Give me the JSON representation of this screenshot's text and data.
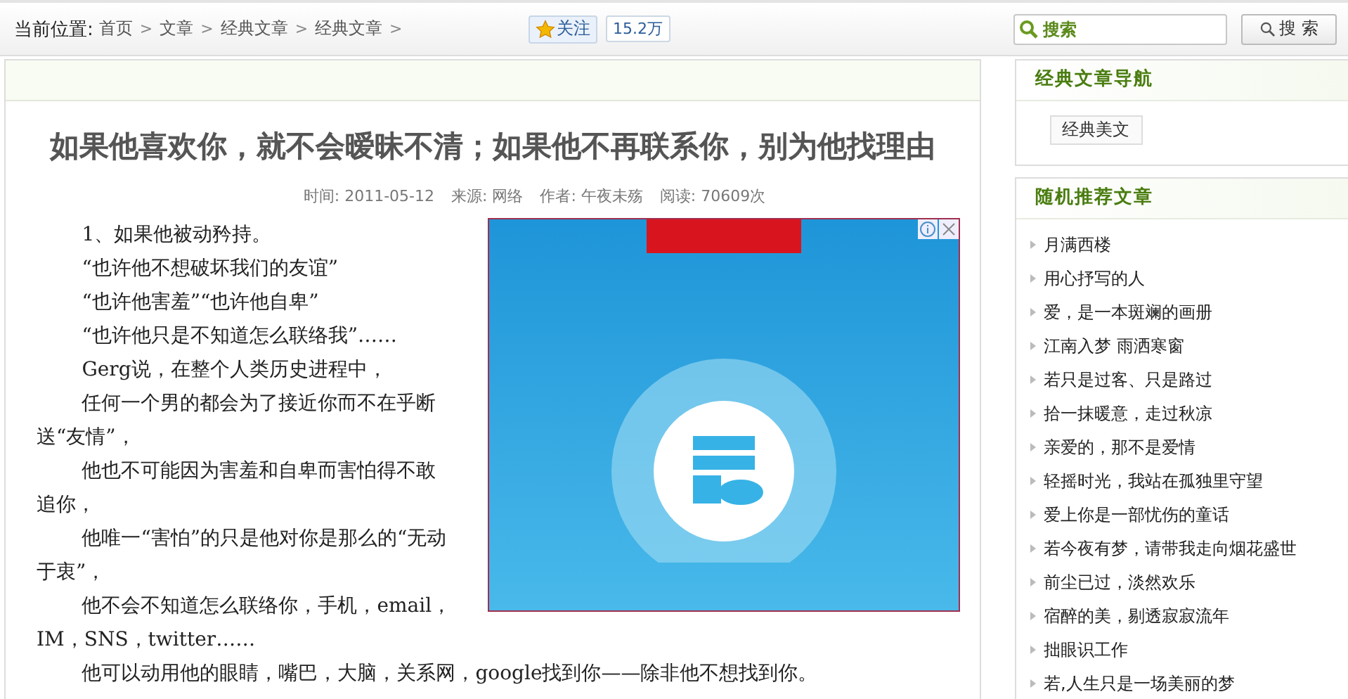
{
  "breadcrumb": {
    "label": "当前位置:",
    "items": [
      "首页",
      "文章",
      "经典文章",
      "经典文章"
    ],
    "separator": ">"
  },
  "follow": {
    "label": "关注",
    "count": "15.2万"
  },
  "search": {
    "placeholder": "搜索",
    "button": "搜 索"
  },
  "article": {
    "title": "如果他喜欢你，就不会暧昧不清；如果他不再联系你，别为他找理由",
    "meta": [
      {
        "label": "时间:",
        "value": "2011-05-12"
      },
      {
        "label": "来源:",
        "value": "网络"
      },
      {
        "label": "作者:",
        "value": "午夜未殇"
      },
      {
        "label": "阅读:",
        "value": "70609次"
      }
    ],
    "paragraphs": [
      "1、如果他被动矜持。",
      "“也许他不想破坏我们的友谊”",
      "“也许他害羞”“也许他自卑”",
      "“也许他只是不知道怎么联络我”……",
      "Gerg说，在整个人类历史进程中，",
      "任何一个男的都会为了接近你而不在乎断送“友情”，",
      "他也不可能因为害羞和自卑而害怕得不敢追你，",
      "他唯一“害怕”的只是他对你是那么的“无动于衷”，",
      "他不会不知道怎么联络你，手机，email，IM，SNS，twitter……",
      "他可以动用他的眼睛，嘴巴，大脑，关系网，google找到你——除非他不想找到你。"
    ]
  },
  "sidebar": [
    {
      "kind": "tags",
      "title": "经典文章导航",
      "items": [
        "经典美文"
      ]
    },
    {
      "kind": "list",
      "title": "随机推荐文章",
      "items": [
        "月满西楼",
        "用心抒写的人",
        "爱，是一本斑斓的画册",
        "江南入梦 雨洒寒窗",
        "若只是过客、只是路过",
        "拾一抹暖意，走过秋凉",
        "亲爱的，那不是爱情",
        "轻摇时光，我站在孤独里守望",
        "爱上你是一部忧伤的童话",
        "若今夜有梦，请带我走向烟花盛世",
        "前尘已过，淡然欢乐",
        "宿醉的美，剔透寂寂流年",
        "拙眼识工作",
        "若,人生只是一场美丽的梦"
      ]
    }
  ]
}
